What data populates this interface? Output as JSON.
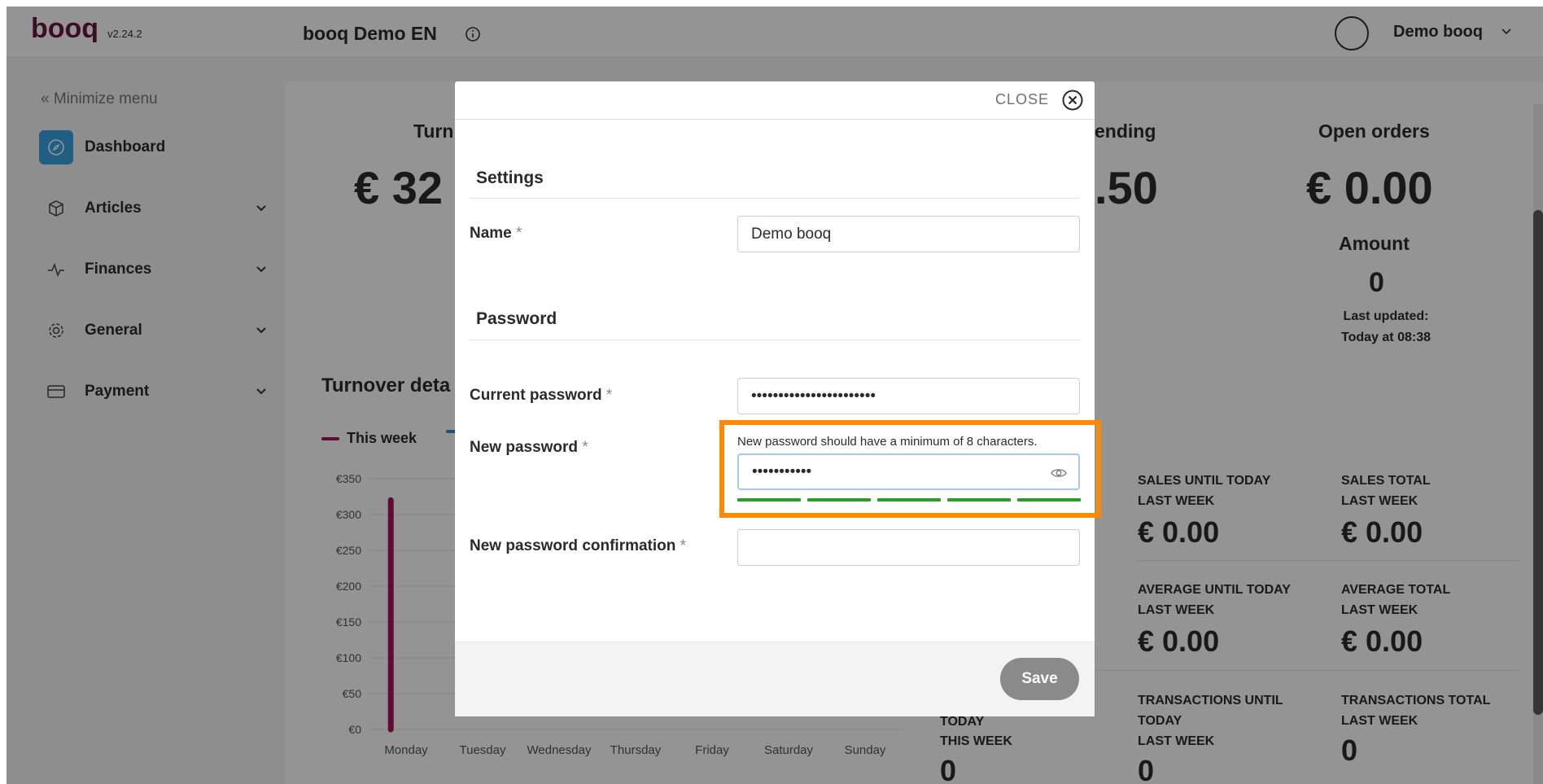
{
  "header": {
    "brand": "booq",
    "version": "v2.24.2",
    "app_title": "booq Demo EN",
    "user_name": "Demo booq"
  },
  "sidebar": {
    "minimize_label": "Minimize menu",
    "items": [
      {
        "label": "Dashboard",
        "icon": "compass-icon"
      },
      {
        "label": "Articles",
        "icon": "box-icon"
      },
      {
        "label": "Finances",
        "icon": "pulse-icon"
      },
      {
        "label": "General",
        "icon": "gear-icon"
      },
      {
        "label": "Payment",
        "icon": "card-icon"
      }
    ]
  },
  "dashboard": {
    "kpis": [
      {
        "title": "Turn",
        "value": "€ 32"
      },
      {
        "title": "ending",
        "value": ".50"
      },
      {
        "title": "Open orders",
        "value": "€ 0.00"
      }
    ],
    "amount_label": "Amount",
    "amount_value": "0",
    "last_updated_label": "Last updated:",
    "last_updated_value": "Today at 08:38",
    "chart_title": "Turnover deta",
    "stats": [
      {
        "label1": "SALES UNTIL TODAY",
        "label2": "LAST WEEK",
        "value": "€ 0.00"
      },
      {
        "label1": "SALES TOTAL",
        "label2": "LAST WEEK",
        "value": "€ 0.00"
      },
      {
        "label1": "AVERAGE UNTIL TODAY",
        "label2": "LAST WEEK",
        "value": "€ 0.00"
      },
      {
        "label1": "AVERAGE TOTAL",
        "label2": "LAST WEEK",
        "value": "€ 0.00"
      },
      {
        "label1": "TODAY",
        "label2": "THIS WEEK",
        "value": "0"
      },
      {
        "label1": "TRANSACTIONS UNTIL",
        "label2": "TODAY",
        "label3": "LAST WEEK",
        "value": "0"
      },
      {
        "label1": "TRANSACTIONS TOTAL",
        "label2": "LAST WEEK",
        "value": "0"
      }
    ]
  },
  "chart_data": {
    "type": "bar",
    "categories": [
      "Monday",
      "Tuesday",
      "Wednesday",
      "Thursday",
      "Friday",
      "Saturday",
      "Sunday"
    ],
    "y_ticks": [
      "€0",
      "€50",
      "€100",
      "€150",
      "€200",
      "€250",
      "€300",
      "€350"
    ],
    "ylim": [
      0,
      350
    ],
    "series": [
      {
        "name": "This week",
        "color": "#a0185c",
        "values": [
          320,
          0,
          0,
          0,
          0,
          0,
          0
        ]
      }
    ],
    "legend_second_color": "#2a8fd0",
    "grid": true,
    "legend": "top-left"
  },
  "modal": {
    "close_label": "CLOSE",
    "settings_title": "Settings",
    "name_label": "Name",
    "name_value": "Demo booq",
    "password_title": "Password",
    "current_password_label": "Current password",
    "current_password_value": "•••••••••••••••••••••••",
    "new_password_label": "New password",
    "new_password_hint": "New password should have a minimum of 8 characters.",
    "new_password_value": "•••••••••••",
    "confirm_label": "New password confirmation",
    "confirm_value": "",
    "required_mark": "*",
    "save_label": "Save",
    "strength_segments_filled": 5
  },
  "colors": {
    "accent": "#3aa3e3",
    "highlight": "#ff8a00",
    "strength": "#2e9a2e"
  }
}
